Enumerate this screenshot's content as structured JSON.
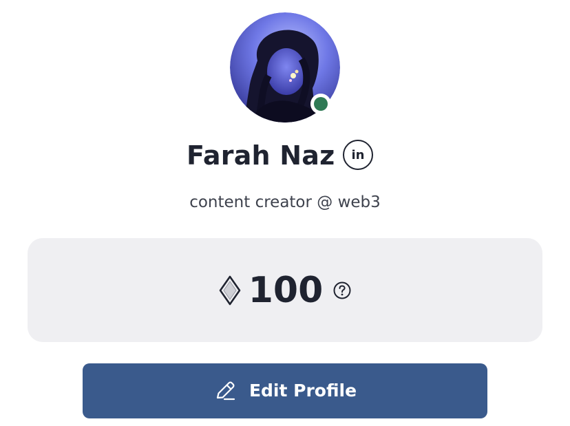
{
  "profile": {
    "name": "Farah Naz",
    "tagline": "content creator @ web3",
    "status": "online",
    "social": {
      "linkedin_label": "in"
    }
  },
  "points": {
    "value": "100",
    "icon": "diamond-gem-icon",
    "help_icon": "question-circle-icon"
  },
  "actions": {
    "edit_profile_label": "Edit Profile",
    "edit_icon": "pencil-icon"
  },
  "colors": {
    "text_dark": "#1f2330",
    "text_muted": "#3e424d",
    "card_bg": "#efeff2",
    "button_bg": "#3a5a8c",
    "status_online": "#2f7a55"
  }
}
